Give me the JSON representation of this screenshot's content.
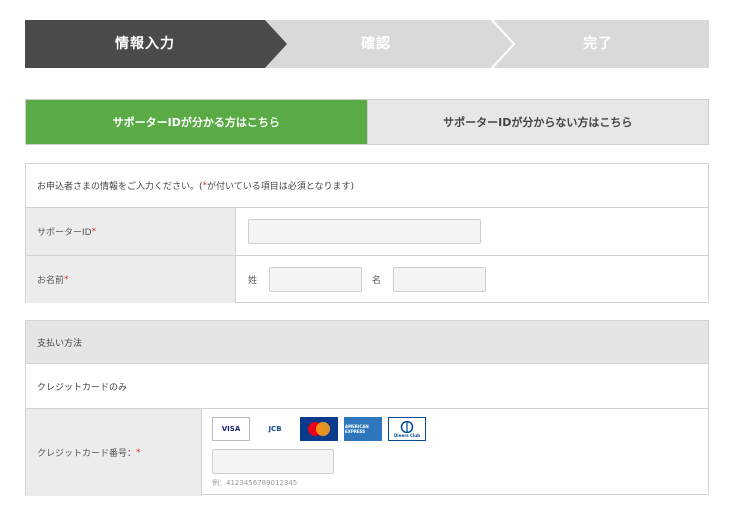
{
  "stepper": {
    "steps": [
      {
        "label": "情報入力",
        "state": "active",
        "color": "#4a4a4a"
      },
      {
        "label": "確認",
        "state": "inactive",
        "color": "#d9d9d9"
      },
      {
        "label": "完了",
        "state": "inactive",
        "color": "#d9d9d9"
      }
    ]
  },
  "tabs": {
    "known": "サポーターIDが分かる方はこちら",
    "unknown": "サポーターIDが分からない方はこちら",
    "active_color": "#5aab46"
  },
  "applicant": {
    "intro_prefix": "お申込者さまの情報をご入力ください。(",
    "intro_star": "*",
    "intro_suffix": "が付いている項目は必須となります)",
    "supporter_id_label": "サポーターID",
    "name_label": "お名前",
    "required_mark": "*",
    "last_name_label": "姓",
    "first_name_label": "名",
    "supporter_id_value": "",
    "last_name_value": "",
    "first_name_value": ""
  },
  "payment": {
    "section_title": "支払い方法",
    "method_note": "クレジットカードのみ",
    "card_number_label": "クレジットカード番号：",
    "required_mark": "*",
    "card_number_value": "",
    "example": "例：4123456789012345",
    "card_brands": [
      {
        "name": "VISA",
        "bg": "#ffffff",
        "fg": "#1a1f71"
      },
      {
        "name": "JCB",
        "bg": "#ffffff",
        "fg": "#0e4c96"
      },
      {
        "name": "MasterCard",
        "bg": "#0a3a8c",
        "fg": "#f79e1b"
      },
      {
        "name": "AMERICAN EXPRESS",
        "bg": "#2e77bc",
        "fg": "#ffffff"
      },
      {
        "name": "Diners Club",
        "bg": "#ffffff",
        "fg": "#004a97"
      }
    ]
  }
}
